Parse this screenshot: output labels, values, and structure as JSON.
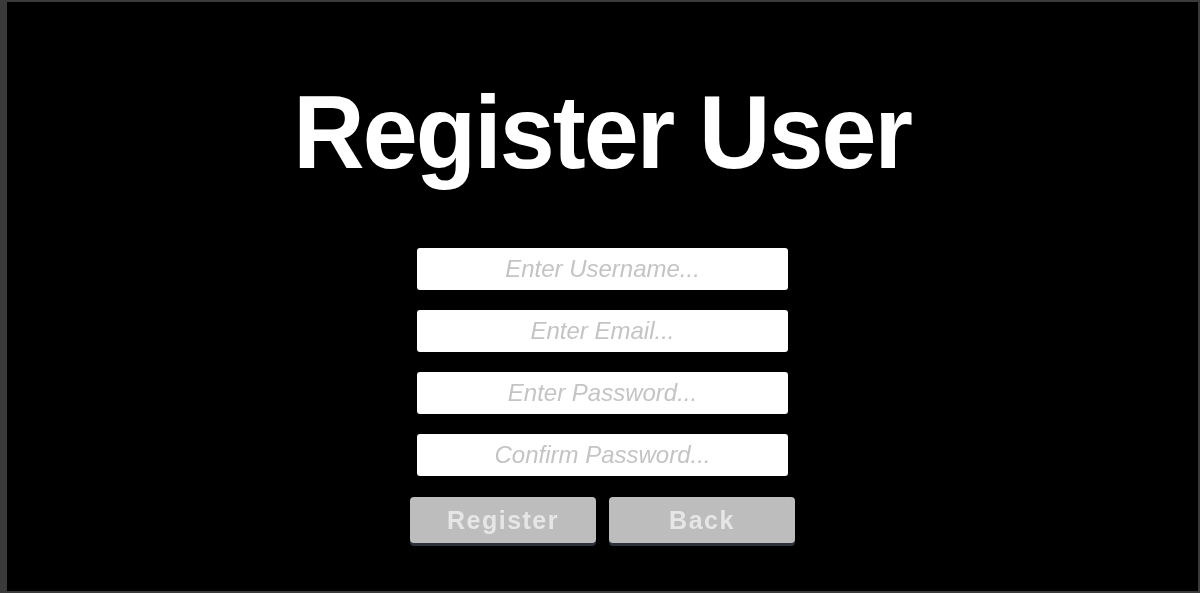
{
  "title": "Register User",
  "fields": [
    {
      "placeholder": "Enter Username..."
    },
    {
      "placeholder": "Enter Email..."
    },
    {
      "placeholder": "Enter Password..."
    },
    {
      "placeholder": "Confirm Password..."
    }
  ],
  "buttons": [
    {
      "label": "Register",
      "disabled": true
    },
    {
      "label": "Back",
      "disabled": true
    }
  ]
}
